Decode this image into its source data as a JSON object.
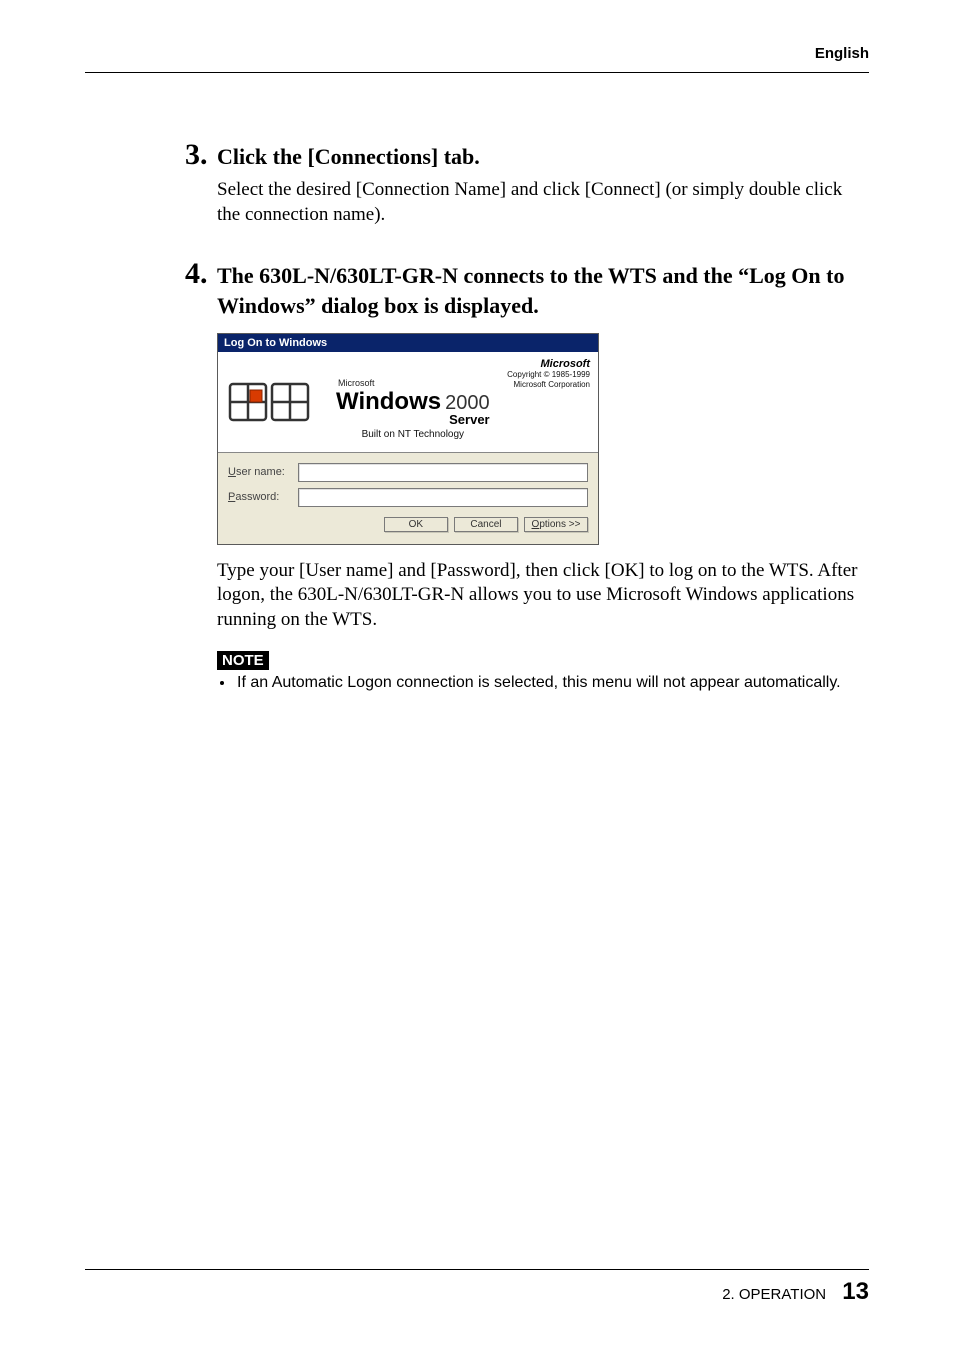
{
  "header": {
    "lang": "English"
  },
  "steps": [
    {
      "num": "3.",
      "title": "Click the [Connections] tab.",
      "body": "Select the desired [Connection Name] and click [Connect] (or simply double click the connection name)."
    },
    {
      "num": "4.",
      "title": "The 630L-N/630LT-GR-N connects to the WTS and the “Log On to Windows” dialog box is displayed.",
      "body_after": "Type your [User name] and [Password], then click [OK] to log on to the WTS. After logon, the 630L-N/630LT-GR-N allows you to use Microsoft Windows applications running on the WTS."
    }
  ],
  "dialog": {
    "title": "Log On to Windows",
    "brand_word": "Microsoft",
    "copyright_line1": "Copyright © 1985-1999",
    "copyright_line2": "Microsoft Corporation",
    "small_ms": "Microsoft",
    "win_word": "Windows",
    "y2k": "2000",
    "server": "Server",
    "built": "Built on NT Technology",
    "username_label": "User name:",
    "password_label": "Password:",
    "buttons": {
      "ok": "OK",
      "cancel": "Cancel",
      "options": "Options >>"
    },
    "ok_underline": "O",
    "cancel_text": "Cancel",
    "options_underline": "O"
  },
  "note": {
    "badge": "NOTE",
    "items": [
      "If an Automatic Logon connection is selected, this menu will not appear automatically."
    ]
  },
  "footer": {
    "section": "2. OPERATION",
    "page": "13"
  }
}
